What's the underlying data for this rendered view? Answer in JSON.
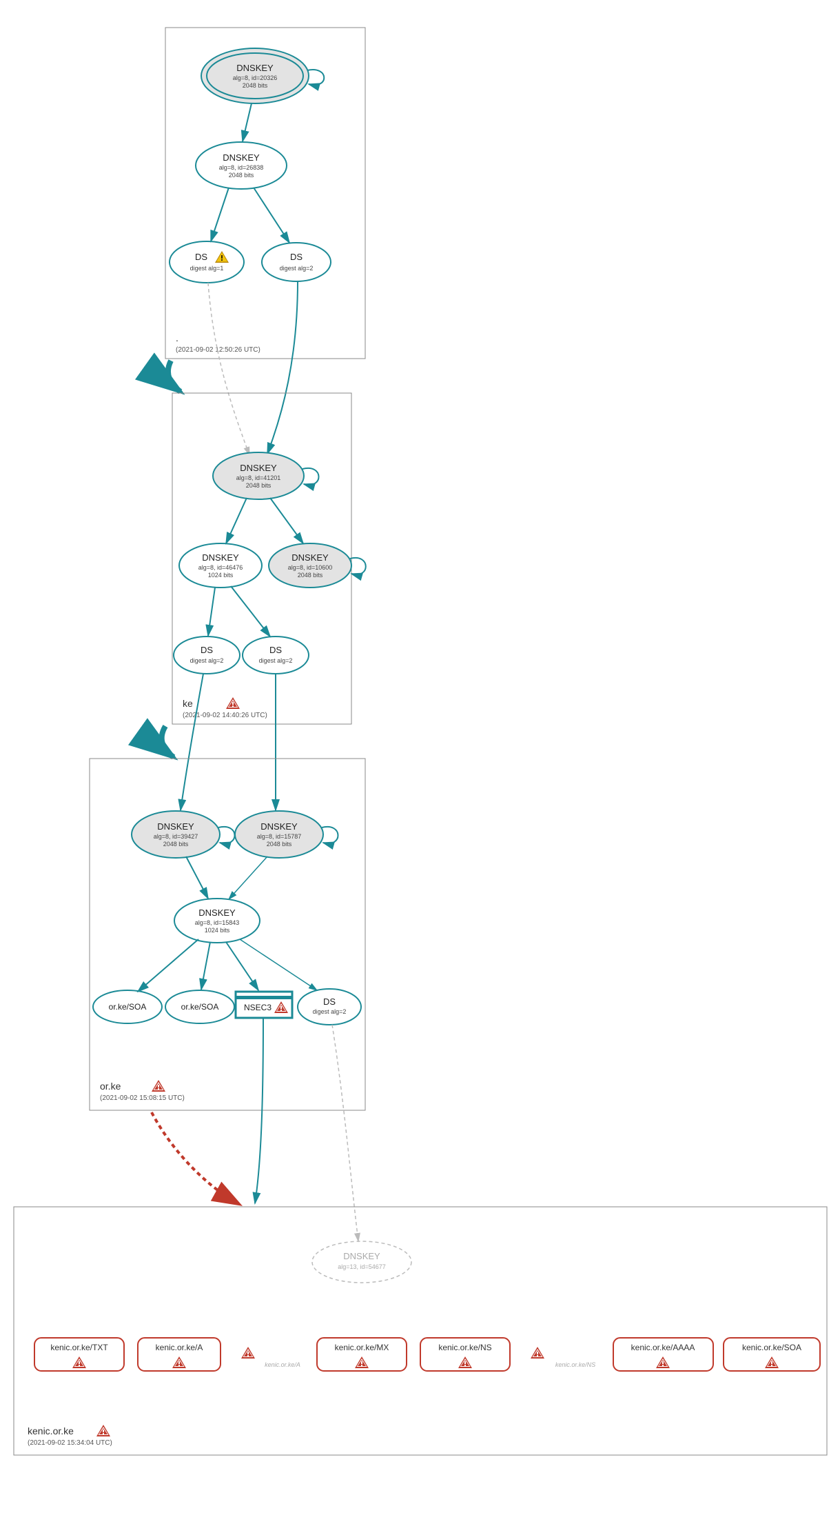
{
  "colors": {
    "teal": "#1b8a96",
    "red": "#c0392b",
    "gray": "#bbb",
    "yellow": "#f1c40f"
  },
  "zones": {
    "root": {
      "name": ".",
      "timestamp": "(2021-09-02 12:50:26 UTC)"
    },
    "ke": {
      "name": "ke",
      "timestamp": "(2021-09-02 14:40:26 UTC)"
    },
    "orke": {
      "name": "or.ke",
      "timestamp": "(2021-09-02 15:08:15 UTC)"
    },
    "kenic": {
      "name": "kenic.or.ke",
      "timestamp": "(2021-09-02 15:34:04 UTC)"
    }
  },
  "nodes": {
    "root_ksk": {
      "title": "DNSKEY",
      "sub1": "alg=8, id=20326",
      "sub2": "2048 bits"
    },
    "root_zsk": {
      "title": "DNSKEY",
      "sub1": "alg=8, id=26838",
      "sub2": "2048 bits"
    },
    "root_ds1": {
      "title": "DS",
      "sub1": "digest alg=1"
    },
    "root_ds2": {
      "title": "DS",
      "sub1": "digest alg=2"
    },
    "ke_ksk": {
      "title": "DNSKEY",
      "sub1": "alg=8, id=41201",
      "sub2": "2048 bits"
    },
    "ke_zsk1": {
      "title": "DNSKEY",
      "sub1": "alg=8, id=46476",
      "sub2": "1024 bits"
    },
    "ke_zsk2": {
      "title": "DNSKEY",
      "sub1": "alg=8, id=10600",
      "sub2": "2048 bits"
    },
    "ke_ds1": {
      "title": "DS",
      "sub1": "digest alg=2"
    },
    "ke_ds2": {
      "title": "DS",
      "sub1": "digest alg=2"
    },
    "orke_k1": {
      "title": "DNSKEY",
      "sub1": "alg=8, id=39427",
      "sub2": "2048 bits"
    },
    "orke_k2": {
      "title": "DNSKEY",
      "sub1": "alg=8, id=15787",
      "sub2": "2048 bits"
    },
    "orke_zsk": {
      "title": "DNSKEY",
      "sub1": "alg=8, id=15843",
      "sub2": "1024 bits"
    },
    "orke_soa1": {
      "title": "or.ke/SOA"
    },
    "orke_soa2": {
      "title": "or.ke/SOA"
    },
    "orke_nsec3": {
      "title": "NSEC3"
    },
    "orke_ds": {
      "title": "DS",
      "sub1": "digest alg=2"
    },
    "kenic_key": {
      "title": "DNSKEY",
      "sub1": "alg=13, id=54677"
    },
    "kenic_txt": {
      "title": "kenic.or.ke/TXT"
    },
    "kenic_a": {
      "title": "kenic.or.ke/A"
    },
    "kenic_mx": {
      "title": "kenic.or.ke/MX"
    },
    "kenic_ns": {
      "title": "kenic.or.ke/NS"
    },
    "kenic_aaaa": {
      "title": "kenic.or.ke/AAAA"
    },
    "kenic_soa": {
      "title": "kenic.or.ke/SOA"
    }
  },
  "hints": {
    "a": "kenic.or.ke/A",
    "ns": "kenic.or.ke/NS"
  }
}
